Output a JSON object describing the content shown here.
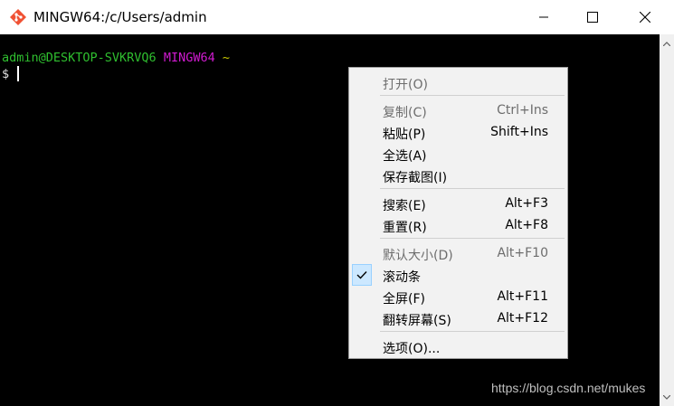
{
  "window": {
    "title": "MINGW64:/c/Users/admin",
    "icon": "git-diamond-icon",
    "controls": {
      "minimize": "minimize-icon",
      "maximize": "maximize-icon",
      "close": "close-icon"
    }
  },
  "terminal": {
    "user_host": "admin@DESKTOP-SVKRVQ6",
    "system": "MINGW64",
    "path": "~",
    "prompt": "$",
    "colors": {
      "background": "#000000",
      "user": "#2fbf2f",
      "system": "#d11bd1",
      "path": "#c8c800"
    }
  },
  "context_menu": {
    "items": [
      {
        "label": "打开(O)",
        "shortcut": "",
        "disabled": true
      },
      {
        "label": "复制(C)",
        "shortcut": "Ctrl+Ins",
        "disabled": true
      },
      {
        "label": "粘贴(P)",
        "shortcut": "Shift+Ins",
        "disabled": false
      },
      {
        "label": "全选(A)",
        "shortcut": "",
        "disabled": false
      },
      {
        "label": "保存截图(I)",
        "shortcut": "",
        "disabled": false
      },
      {
        "label": "搜索(E)",
        "shortcut": "Alt+F3",
        "disabled": false
      },
      {
        "label": "重置(R)",
        "shortcut": "Alt+F8",
        "disabled": false
      },
      {
        "label": "默认大小(D)",
        "shortcut": "Alt+F10",
        "disabled": true
      },
      {
        "label": "滚动条",
        "shortcut": "",
        "disabled": false,
        "checked": true
      },
      {
        "label": "全屏(F)",
        "shortcut": "Alt+F11",
        "disabled": false
      },
      {
        "label": "翻转屏幕(S)",
        "shortcut": "Alt+F12",
        "disabled": false
      },
      {
        "label": "选项(O)...",
        "shortcut": "",
        "disabled": false
      }
    ],
    "check_icon": "checkmark-icon"
  },
  "watermark": "https://blog.csdn.net/mukes"
}
